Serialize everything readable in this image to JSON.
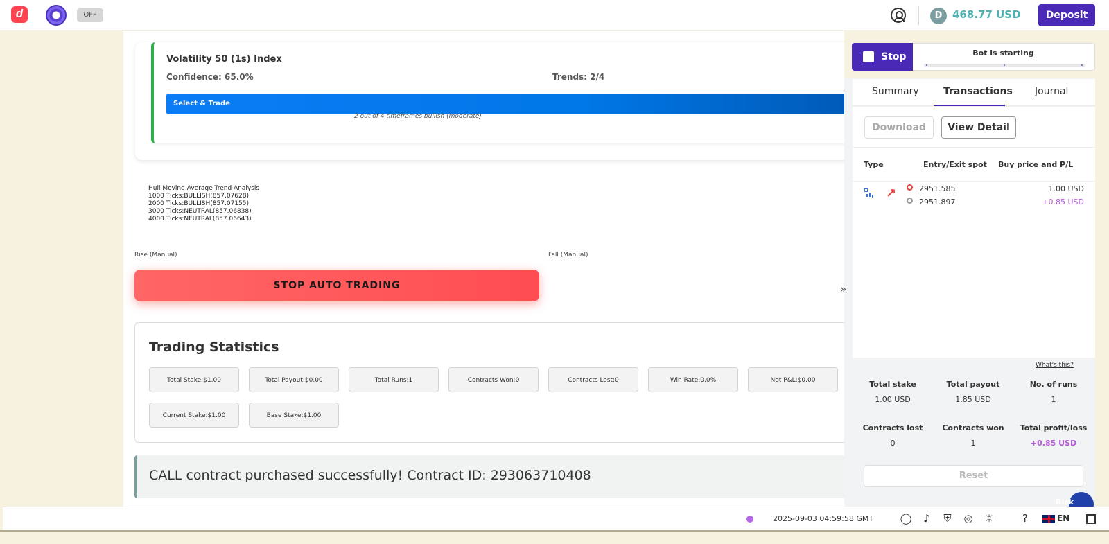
{
  "header": {
    "toggle_label": "OFF",
    "balance": "468.77 USD",
    "currency_symbol": "D",
    "deposit_label": "Deposit"
  },
  "signal": {
    "title": "Volatility 50 (1s) Index",
    "confidence": "Confidence: 65.0%",
    "trends": "Trends: 2/4",
    "select_label": "Select & Trade",
    "note": "2 out of 4 timeframes bullish (moderate)"
  },
  "hull": {
    "title": "Hull Moving Average Trend Analysis",
    "lines": [
      "1000 Ticks:BULLISH(857.07628)",
      "2000 Ticks:BULLISH(857.07155)",
      "3000 Ticks:NEUTRAL(857.06838)",
      "4000 Ticks:NEUTRAL(857.06643)"
    ]
  },
  "manual": {
    "rise_label": "Rise (Manual)",
    "fall_label": "Fall (Manual)",
    "stop_auto_label": "STOP AUTO TRADING"
  },
  "stats": {
    "title": "Trading Statistics",
    "items": [
      "Total Stake:$1.00",
      "Total Payout:$0.00",
      "Total Runs:1",
      "Contracts Won:0",
      "Contracts Lost:0",
      "Win Rate:0.0%",
      "Net P&L:$0.00",
      "Current Stake:$1.00",
      "Base Stake:$1.00"
    ]
  },
  "toast": {
    "message": "CALL contract purchased successfully! Contract ID: 293063710408"
  },
  "run_panel": {
    "stop_label": "Stop",
    "status": "Bot is starting",
    "tabs": [
      "Summary",
      "Transactions",
      "Journal"
    ],
    "download_label": "Download",
    "view_detail_label": "View Detail",
    "columns": [
      "Type",
      "Entry/Exit spot",
      "Buy price and P/L"
    ],
    "transaction": {
      "entry_spot": "2951.585",
      "exit_spot": "2951.897",
      "buy_price": "1.00 USD",
      "pl": "+0.85 USD"
    },
    "whats_this": "What's this?",
    "summary": [
      {
        "label": "Total stake",
        "value": "1.00 USD"
      },
      {
        "label": "Total payout",
        "value": "1.85 USD"
      },
      {
        "label": "No. of runs",
        "value": "1"
      },
      {
        "label": "Contracts lost",
        "value": "0"
      },
      {
        "label": "Contracts won",
        "value": "1"
      },
      {
        "label": "Total profit/loss",
        "value": "+0.85 USD"
      }
    ],
    "reset_label": "Reset",
    "chat_label": "Risk claim"
  },
  "footer": {
    "datetime": "2025-09-03 04:59:58 GMT",
    "language": "EN"
  },
  "colors": {
    "brand": "#4929b5",
    "balance": "#4bb4b3",
    "profit": "#b45bd9",
    "stop_auto": "#ff5050",
    "signal_border": "#2eaf4e"
  },
  "icons": [
    "deriv-logo-icon",
    "bot-icon",
    "account-icon",
    "currency-icon",
    "whatsapp-icon",
    "deriv-icon",
    "shield-icon",
    "gamble-icon",
    "theme-icon",
    "help-icon",
    "flag-icon",
    "fullscreen-icon"
  ]
}
